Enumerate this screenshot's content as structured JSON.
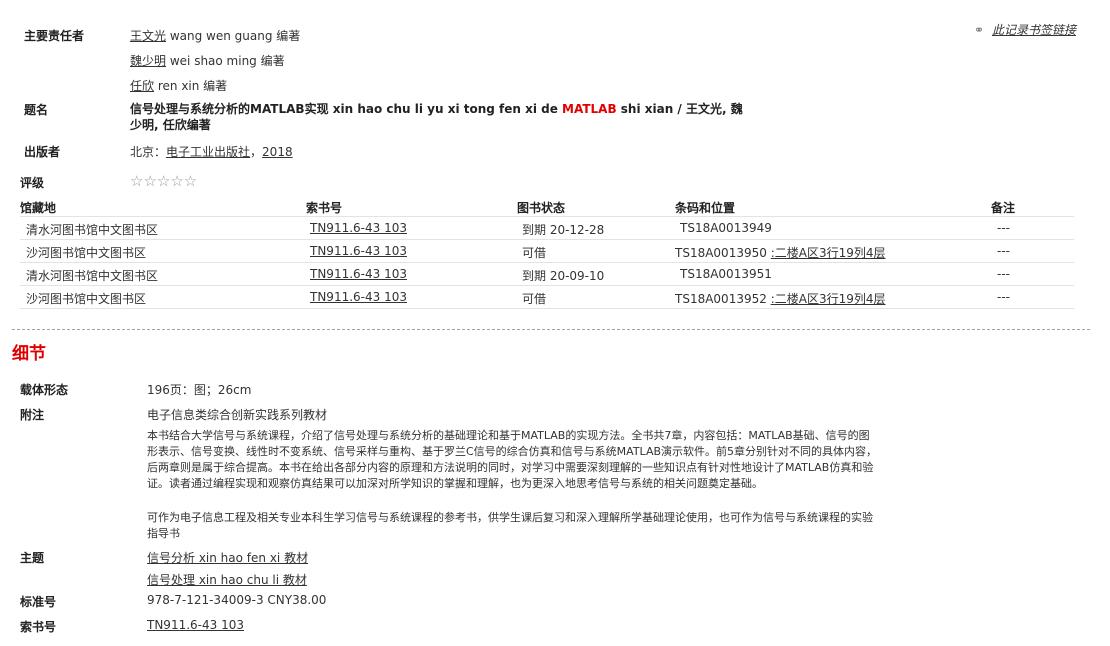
{
  "top_link": {
    "icon": "link-icon",
    "label": "此记录书签链接"
  },
  "author_label": "主要责任者",
  "authors": [
    {
      "name": "王文光",
      "rest": "wang wen guang 编著"
    },
    {
      "name": "魏少明",
      "rest": "wei shao ming 编著"
    },
    {
      "name": "任欣",
      "rest": "ren xin 编著"
    }
  ],
  "title_label": "题名",
  "title_part1": "信号处理与系统分析的MATLAB实现 xin hao chu li yu xi tong fen xi de ",
  "title_highlight": "MATLAB",
  "title_part2": " shi xian / 王文光, 魏",
  "title_line2": "少明, 任欣编著",
  "publisher_label": "出版者",
  "publisher_place": "北京：",
  "publisher_name": "电子工业出版社",
  "publisher_sep": "，",
  "publisher_year": "2018",
  "rating_label": "评级",
  "rating_stars": "☆☆☆☆☆",
  "holdings": {
    "headers": {
      "location": "馆藏地",
      "callno": "索书号",
      "status": "图书状态",
      "barcode": "条码和位置",
      "note": "备注"
    },
    "rows": [
      {
        "location": "清水河图书馆中文图书区",
        "callno": "TN911.6-43 103",
        "status": "到期 20-12-28",
        "barcode": "TS18A0013949",
        "shelf": "",
        "note": "---"
      },
      {
        "location": "沙河图书馆中文图书区",
        "callno": "TN911.6-43 103",
        "status": "可借",
        "barcode": "TS18A0013950",
        "shelf": ":二楼A区3行19列4层",
        "note": "---"
      },
      {
        "location": "清水河图书馆中文图书区",
        "callno": "TN911.6-43 103",
        "status": "到期 20-09-10",
        "barcode": "TS18A0013951",
        "shelf": "",
        "note": "---"
      },
      {
        "location": "沙河图书馆中文图书区",
        "callno": "TN911.6-43 103",
        "status": "可借",
        "barcode": "TS18A0013952",
        "shelf": ":二楼A区3行19列4层",
        "note": "---"
      }
    ]
  },
  "details_title": "细节",
  "details": {
    "format_label": "载体形态",
    "format": "196页：图；26cm",
    "notes_label": "附注",
    "note_series": "电子信息类综合创新实践系列教材",
    "note_summary": "本书结合大学信号与系统课程，介绍了信号处理与系统分析的基础理论和基于MATLAB的实现方法。全书共7章，内容包括：MATLAB基础、信号的图形表示、信号变换、线性时不变系统、信号采样与重构、基于罗兰C信号的综合仿真和信号与系统MATLAB演示软件。前5章分别针对不同的具体内容，后两章则是属于综合提高。本书在给出各部分内容的原理和方法说明的同时，对学习中需要深刻理解的一些知识点有针对性地设计了MATLAB仿真和验证。读者通过编程实现和观察仿真结果可以加深对所学知识的掌握和理解，也为更深入地思考信号与系统的相关问题奠定基础。",
    "note_audience": "可作为电子信息工程及相关专业本科生学习信号与系统课程的参考书，供学生课后复习和深入理解所学基础理论使用，也可作为信号与系统课程的实验指导书",
    "subject_label": "主题",
    "subjects": [
      "信号分析 xin hao fen xi 教材",
      "信号处理 xin hao chu li 教材"
    ],
    "isbn_label": "标准号",
    "isbn": "978-7-121-34009-3 CNY38.00",
    "callno_label": "索书号",
    "callno": "TN911.6-43 103"
  }
}
